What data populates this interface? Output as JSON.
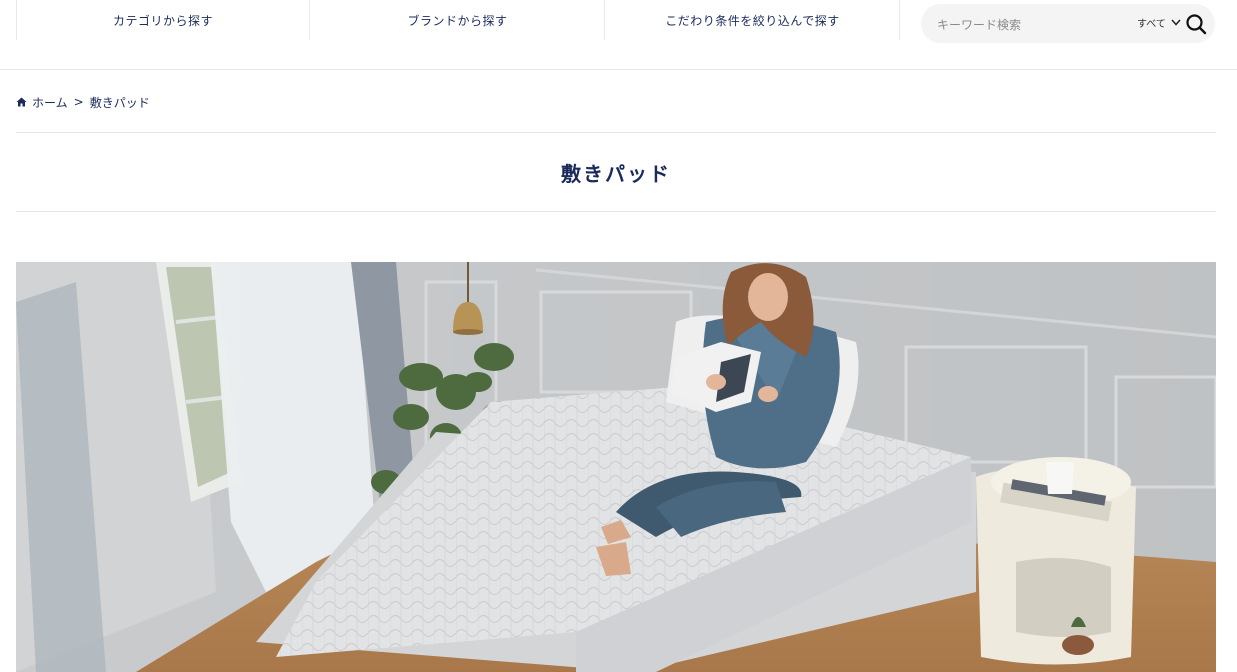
{
  "nav": {
    "tabs": [
      {
        "label": "カテゴリから探す"
      },
      {
        "label": "ブランドから探す"
      },
      {
        "label": "こだわり条件を絞り込んで探す"
      }
    ]
  },
  "search": {
    "placeholder": "キーワード検索",
    "scope_label": "すべて",
    "icons": {
      "scope": "chevron-down-icon",
      "submit": "search-icon"
    }
  },
  "breadcrumb": {
    "home_label": "ホーム",
    "separator": ">",
    "current_label": "敷きパッド",
    "icon": "home-icon"
  },
  "page": {
    "title": "敷きパッド"
  },
  "hero": {
    "image": "woman-reading-on-quilted-mattress-pad"
  },
  "colors": {
    "text_navy": "#1a2b5c",
    "search_bg": "#f4f4f4",
    "divider": "#e6e6e6"
  }
}
